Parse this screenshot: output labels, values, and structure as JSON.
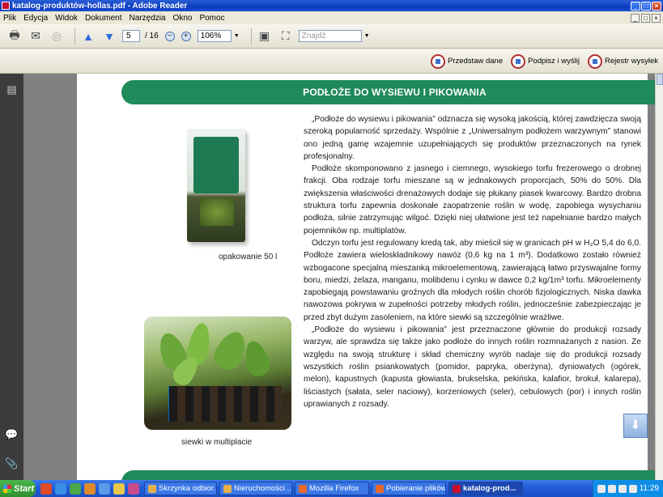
{
  "window": {
    "title": "katalog-produktów-hollas.pdf - Adobe Reader"
  },
  "menu": [
    "Plik",
    "Edycja",
    "Widok",
    "Dokument",
    "Narzędzia",
    "Okno",
    "Pomoc"
  ],
  "toolbar": {
    "page_current": "5",
    "page_total": "/ 16",
    "zoom": "106%",
    "find_placeholder": "Znajdź"
  },
  "toolbar2": {
    "present": "Przedstaw dane",
    "sign": "Podpisz i wyślij",
    "register": "Rejestr wysyłek"
  },
  "document": {
    "header": "PODŁOŻE DO WYSIEWU I PIKOWANIA",
    "caption_bag": "opakowanie 50 l",
    "caption_photo": "siewki w multiplacie",
    "paragraphs": [
      "„Podłoże do wysiewu i pikowania” odznacza się wysoką jakością, której zawdzięcza swoją szeroką popularność sprzedaży. Wspólnie z „Uniwersalnym podłożem warzywnym” stanowi ono jedną gamę wzajemnie uzupełniających się produktów przeznaczonych na rynek profesjonalny.",
      "Podłoże skomponowano z jasnego i ciemnego, wysokiego torfu frezerowego o drobnej frakcji. Oba rodzaje torfu mieszane są w jednakowych proporcjach, 50% do 50%. Dla zwiększenia właściwości drenażowych dodaje się płukany piasek kwarcowy. Bardzo drobna struktura torfu zapewnia doskonałe zaopatrzenie roślin w wodę, zapobiega wysychaniu podłoża, silnie zatrzymując wilgoć. Dzięki niej ułatwione jest też napełnianie bardzo małych pojemników np. multiplatów.",
      "Odczyn torfu jest regulowany kredą tak, aby mieścił się w granicach pH w H₂O 5,4 do 6,0. Podłoże zawiera wieloskładnikowy nawóz (0,6 kg na 1 m³). Dodatkowo zostało również wzbogacone specjalną mieszanką mikroelementową, zawierającą łatwo przyswajalne formy boru, miedzi, żelaza, manganu, molibdenu i cynku w dawce 0,2 kg/1m³ torfu. Mikroelementy zapobiegają powstawaniu groźnych dla młodych roślin chorób fizjologicznych. Niska dawka nawozowa pokrywa w zupełności potrzeby młodych roślin, jednocześnie zabezpieczając je przed zbyt dużym zasoleniem, na które siewki są szczególnie wrażliwe.",
      "„Podłoże do wysiewu i pikowania” jest przeznaczone głównie do produkcji rozsady warzyw, ale sprawdza się także jako podłoże do innych roślin rozmnażanych z nasion. Ze względu na swoją strukturę i skład chemiczny wyrób nadaje się do produkcji rozsady wszystkich roślin psiankowatych (pomidor, papryka, oberżyna), dyniowatych (ogórek, melon), kapustnych (kapusta głowiasta, brukselska, pekińska, kalafior, brokuł, kalarepa), liściastych (sałata, seler naciowy), korzeniowych (seler), cebulowych (por) i innych roślin uprawianych z rozsady."
    ]
  },
  "taskbar": {
    "start": "Start",
    "tasks": [
      "Skrzynka odbior...",
      "Nieruchomości ...",
      "Mozilla Firefox",
      "Pobieranie plików",
      "katalog-prod..."
    ],
    "clock": "11:29"
  }
}
